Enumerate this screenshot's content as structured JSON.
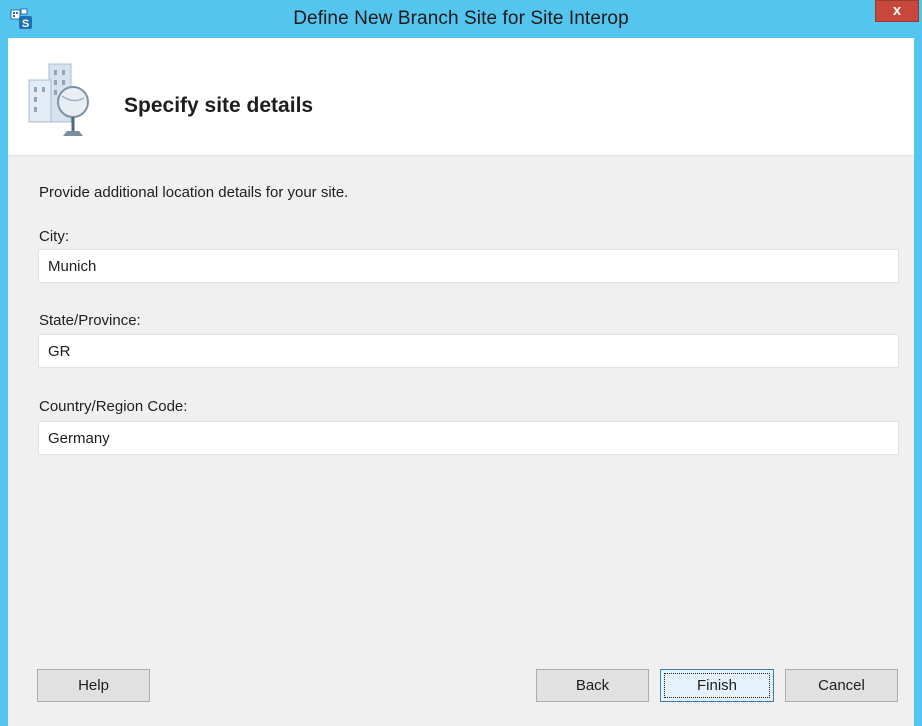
{
  "window": {
    "title": "Define New Branch Site for Site Interop",
    "close_label": "x"
  },
  "header": {
    "title": "Specify site details"
  },
  "form": {
    "description": "Provide additional location details for your site.",
    "city": {
      "label": "City:",
      "value": "Munich"
    },
    "state": {
      "label": "State/Province:",
      "value": "GR"
    },
    "country": {
      "label": "Country/Region Code:",
      "value": "Germany"
    }
  },
  "buttons": {
    "help": "Help",
    "back": "Back",
    "finish": "Finish",
    "cancel": "Cancel"
  },
  "icons": {
    "app": "skype-for-business-topology-icon",
    "header": "branch-site-building-icon",
    "close": "close-icon"
  },
  "colors": {
    "titlebar": "#54c5ef",
    "close_button": "#c8473b",
    "client_background": "#f0f0f0",
    "header_background": "#ffffff"
  }
}
